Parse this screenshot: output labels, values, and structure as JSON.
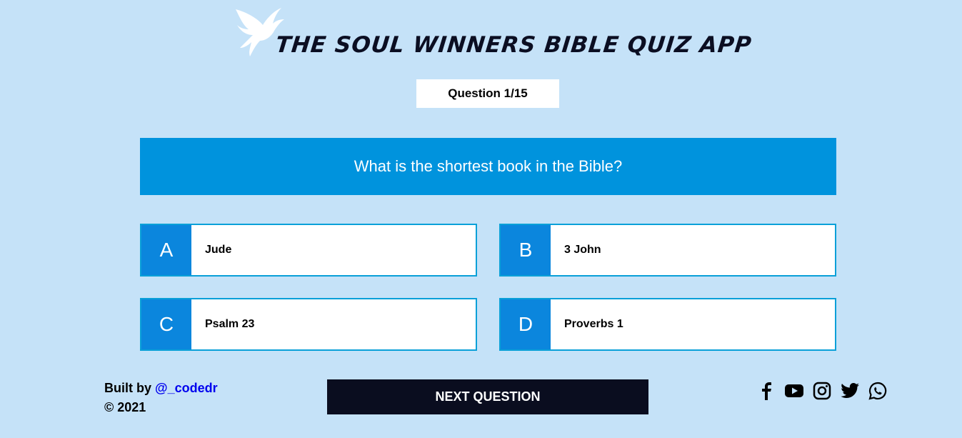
{
  "header": {
    "title": "THE SOUL WINNERS BIBLE QUIZ APP",
    "logo_icon": "dove-icon"
  },
  "quiz": {
    "counter": "Question 1/15",
    "question": "What is the shortest book in the Bible?",
    "options": [
      {
        "letter": "A",
        "text": "Jude"
      },
      {
        "letter": "B",
        "text": "3 John"
      },
      {
        "letter": "C",
        "text": "Psalm 23"
      },
      {
        "letter": "D",
        "text": "Proverbs 1"
      }
    ],
    "next_label": "NEXT QUESTION"
  },
  "footer": {
    "built_by": "Built by",
    "handle": "@_codedr",
    "copyright": "© 2021",
    "social_icons": [
      "facebook-icon",
      "youtube-icon",
      "instagram-icon",
      "twitter-icon",
      "whatsapp-icon"
    ]
  },
  "colors": {
    "background": "#c5e2f8",
    "question_bg": "#0093dd",
    "letter_bg": "#0b86dd",
    "button_bg": "#0a0d1f"
  }
}
